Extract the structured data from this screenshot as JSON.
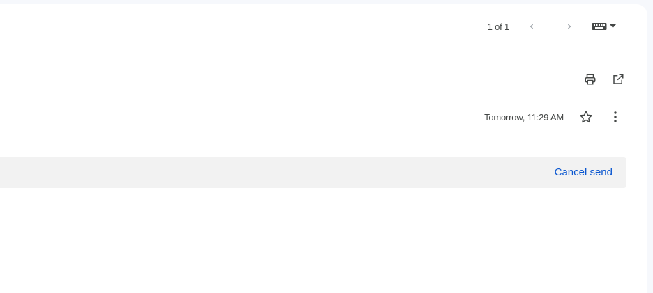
{
  "pager": {
    "count_text": "1 of 1",
    "prev_icon": "chevron-left",
    "next_icon": "chevron-right"
  },
  "input_tools": {
    "icon": "keyboard-icon",
    "menu_icon": "caret-down-icon"
  },
  "actions": {
    "print_icon": "printer-icon",
    "open_new_window_icon": "open-in-new-icon"
  },
  "message": {
    "scheduled_time": "Tomorrow, 11:29 AM",
    "star_icon": "star-outline-icon",
    "more_icon": "more-vertical-icon"
  },
  "banner": {
    "cancel_send_label": "Cancel send"
  },
  "colors": {
    "accent": "#0b57d0",
    "banner_bg": "#f2f2f2",
    "text_secondary": "#444746",
    "icon": "#444746"
  }
}
